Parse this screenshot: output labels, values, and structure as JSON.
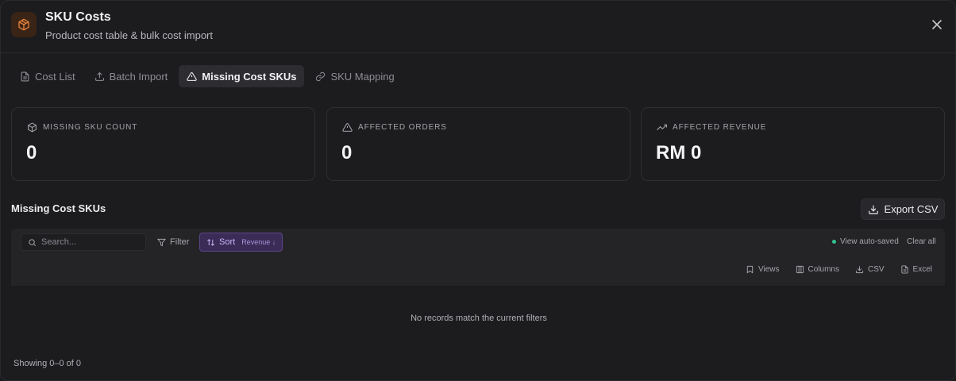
{
  "header": {
    "title": "SKU Costs",
    "subtitle": "Product cost table & bulk cost import",
    "icon": "package-icon",
    "accent": "#e8823a"
  },
  "tabs": [
    {
      "label": "Cost List",
      "icon": "file-icon",
      "active": false
    },
    {
      "label": "Batch Import",
      "icon": "upload-icon",
      "active": false
    },
    {
      "label": "Missing Cost SKUs",
      "icon": "warning-icon",
      "active": true
    },
    {
      "label": "SKU Mapping",
      "icon": "link-icon",
      "active": false
    }
  ],
  "stats": [
    {
      "label": "MISSING SKU COUNT",
      "value": "0",
      "icon": "package-icon"
    },
    {
      "label": "AFFECTED ORDERS",
      "value": "0",
      "icon": "warning-icon"
    },
    {
      "label": "AFFECTED REVENUE",
      "value": "RM 0",
      "icon": "trending-up-icon"
    }
  ],
  "section": {
    "title": "Missing Cost SKUs",
    "export_label": "Export CSV"
  },
  "toolbar": {
    "search_placeholder": "Search...",
    "filter_label": "Filter",
    "sort_label": "Sort",
    "sort_value": "Revenue ↓",
    "autosave_label": "View auto-saved",
    "clear_all_label": "Clear all",
    "views_label": "Views",
    "columns_label": "Columns",
    "csv_label": "CSV",
    "excel_label": "Excel"
  },
  "table": {
    "empty_message": "No records match the current filters"
  },
  "footer": {
    "showing": "Showing 0–0 of 0"
  },
  "colors": {
    "sort_accent": "#c9b6f5",
    "autosave_dot": "#34c38f"
  }
}
